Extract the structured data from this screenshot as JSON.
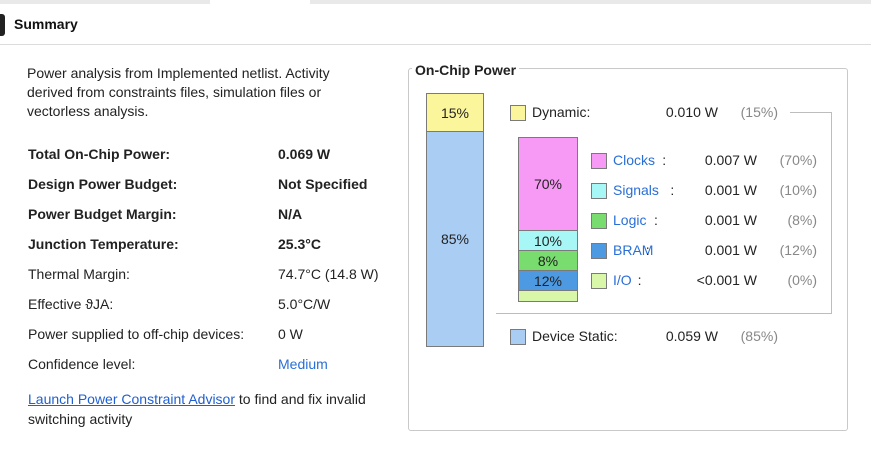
{
  "header": {
    "title": "Summary"
  },
  "description": "Power analysis from Implemented netlist. Activity derived from constraints files, simulation files or vectorless analysis.",
  "summary_rows": [
    {
      "label": "Total On-Chip Power:",
      "value": "0.069 W"
    },
    {
      "label": "Design Power Budget:",
      "value": "Not Specified"
    },
    {
      "label": "Power Budget Margin:",
      "value": "N/A"
    },
    {
      "label": "Junction Temperature:",
      "value": "25.3°C"
    },
    {
      "label": "Thermal Margin:",
      "value": "74.7°C (14.8 W)"
    },
    {
      "label": "Effective ϑJA:",
      "value": "5.0°C/W"
    },
    {
      "label": "Power supplied to off-chip devices:",
      "value": "0 W"
    },
    {
      "label": "Confidence level:",
      "value": "Medium"
    }
  ],
  "advisor": {
    "link_text": "Launch Power Constraint Advisor",
    "rest_text": "to find and fix invalid switching activity"
  },
  "on_chip_power": {
    "title": "On-Chip Power",
    "bar": {
      "dynamic_pct_label": "15%",
      "static_pct_label": "85%",
      "dynamic_fraction": 0.15,
      "static_fraction": 0.85
    },
    "dynamic": {
      "label": "Dynamic:",
      "watts": "0.010 W",
      "pct": "(15%)",
      "color": "#fbf59b"
    },
    "static": {
      "label": "Device Static:",
      "watts": "0.059 W",
      "pct": "(85%)",
      "color": "#a9cdf3"
    },
    "breakdown": [
      {
        "name": "Clocks",
        "watts": "0.007 W",
        "pct": "(70%)",
        "bar_label": "70%",
        "color": "#f79af5"
      },
      {
        "name": "Signals",
        "watts": "0.001 W",
        "pct": "(10%)",
        "bar_label": "10%",
        "color": "#a6f7f5"
      },
      {
        "name": "Logic",
        "watts": "0.001 W",
        "pct": "(8%)",
        "bar_label": "8%",
        "color": "#78dc6e"
      },
      {
        "name": "BRAM",
        "watts": "0.001 W",
        "pct": "(12%)",
        "bar_label": "12%",
        "color": "#4d9ae3"
      },
      {
        "name": "I/O",
        "watts": "<0.001 W",
        "pct": "(0%)",
        "bar_label": "",
        "color": "#d8f7a8"
      }
    ]
  }
}
